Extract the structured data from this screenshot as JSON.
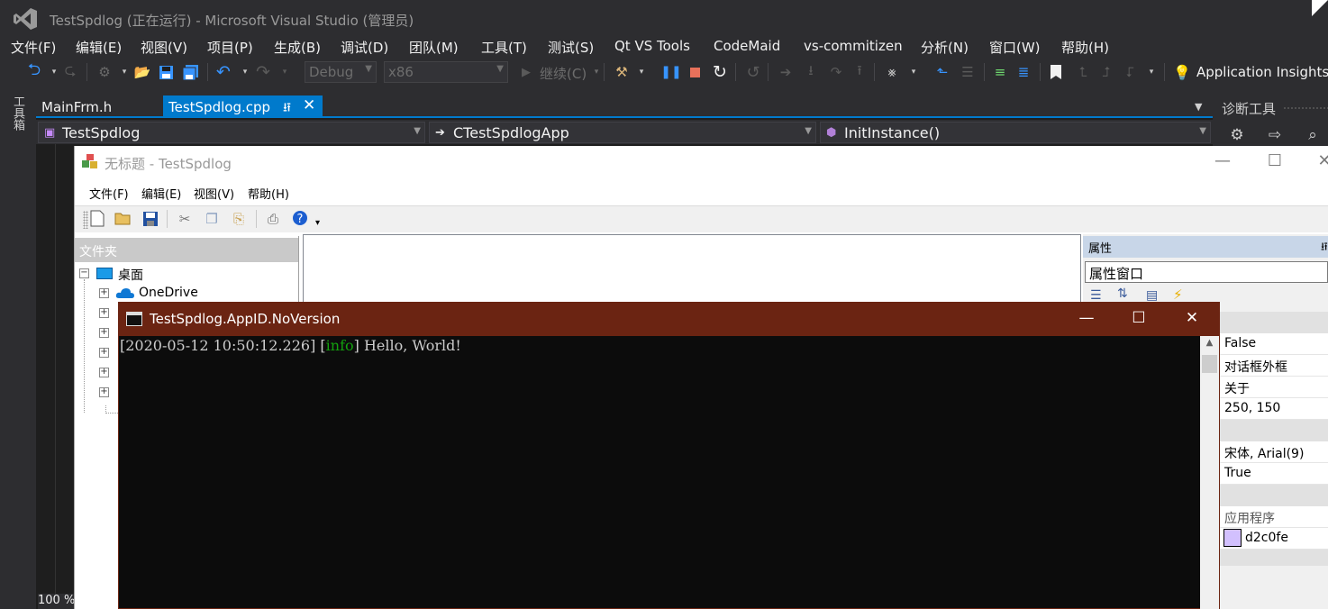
{
  "vs": {
    "window_title": "TestSpdlog (正在运行) - Microsoft Visual Studio (管理员)",
    "menu": [
      "文件(F)",
      "编辑(E)",
      "视图(V)",
      "项目(P)",
      "生成(B)",
      "调试(D)",
      "团队(M)",
      "工具(T)",
      "测试(S)",
      "Qt VS Tools",
      "CodeMaid",
      "vs-commitizen",
      "分析(N)",
      "窗口(W)",
      "帮助(H)"
    ],
    "toolbar": {
      "config": "Debug",
      "platform": "x86",
      "continue_label": "继续(C)",
      "app_insights": "Application Insights"
    },
    "toolbox_label": "工具箱",
    "tabs": [
      {
        "label": "MainFrm.h",
        "active": false
      },
      {
        "label": "TestSpdlog.cpp",
        "active": true
      }
    ],
    "nav": {
      "project": "TestSpdlog",
      "class": "CTestSpdlogApp",
      "member": "InitInstance()"
    },
    "zoom": "100 %",
    "diagnostics": {
      "title": "诊断工具"
    },
    "accent": "#007acc"
  },
  "mfc_app": {
    "title": "无标题 - TestSpdlog",
    "menu": [
      "文件(F)",
      "编辑(E)",
      "视图(V)",
      "帮助(H)"
    ],
    "folder_pane": {
      "title": "文件夹",
      "items": [
        {
          "label": "桌面"
        },
        {
          "label": "OneDrive"
        }
      ]
    },
    "properties": {
      "title": "属性",
      "combo": "属性窗口",
      "values": [
        "False",
        "对话框外框",
        "关于",
        "250, 150",
        "宋体, Arial(9)",
        "True",
        "应用程序",
        "d2c0fe"
      ],
      "swatch_color": "#d2c0fe"
    }
  },
  "console": {
    "title": "TestSpdlog.AppID.NoVersion",
    "timestamp": "[2020-05-12 10:50:12.226]",
    "level_open": " [",
    "level": "info",
    "level_close": "] ",
    "message": "Hello, World!",
    "level_color": "#13a10e",
    "titlebar_color": "#6b2412"
  }
}
